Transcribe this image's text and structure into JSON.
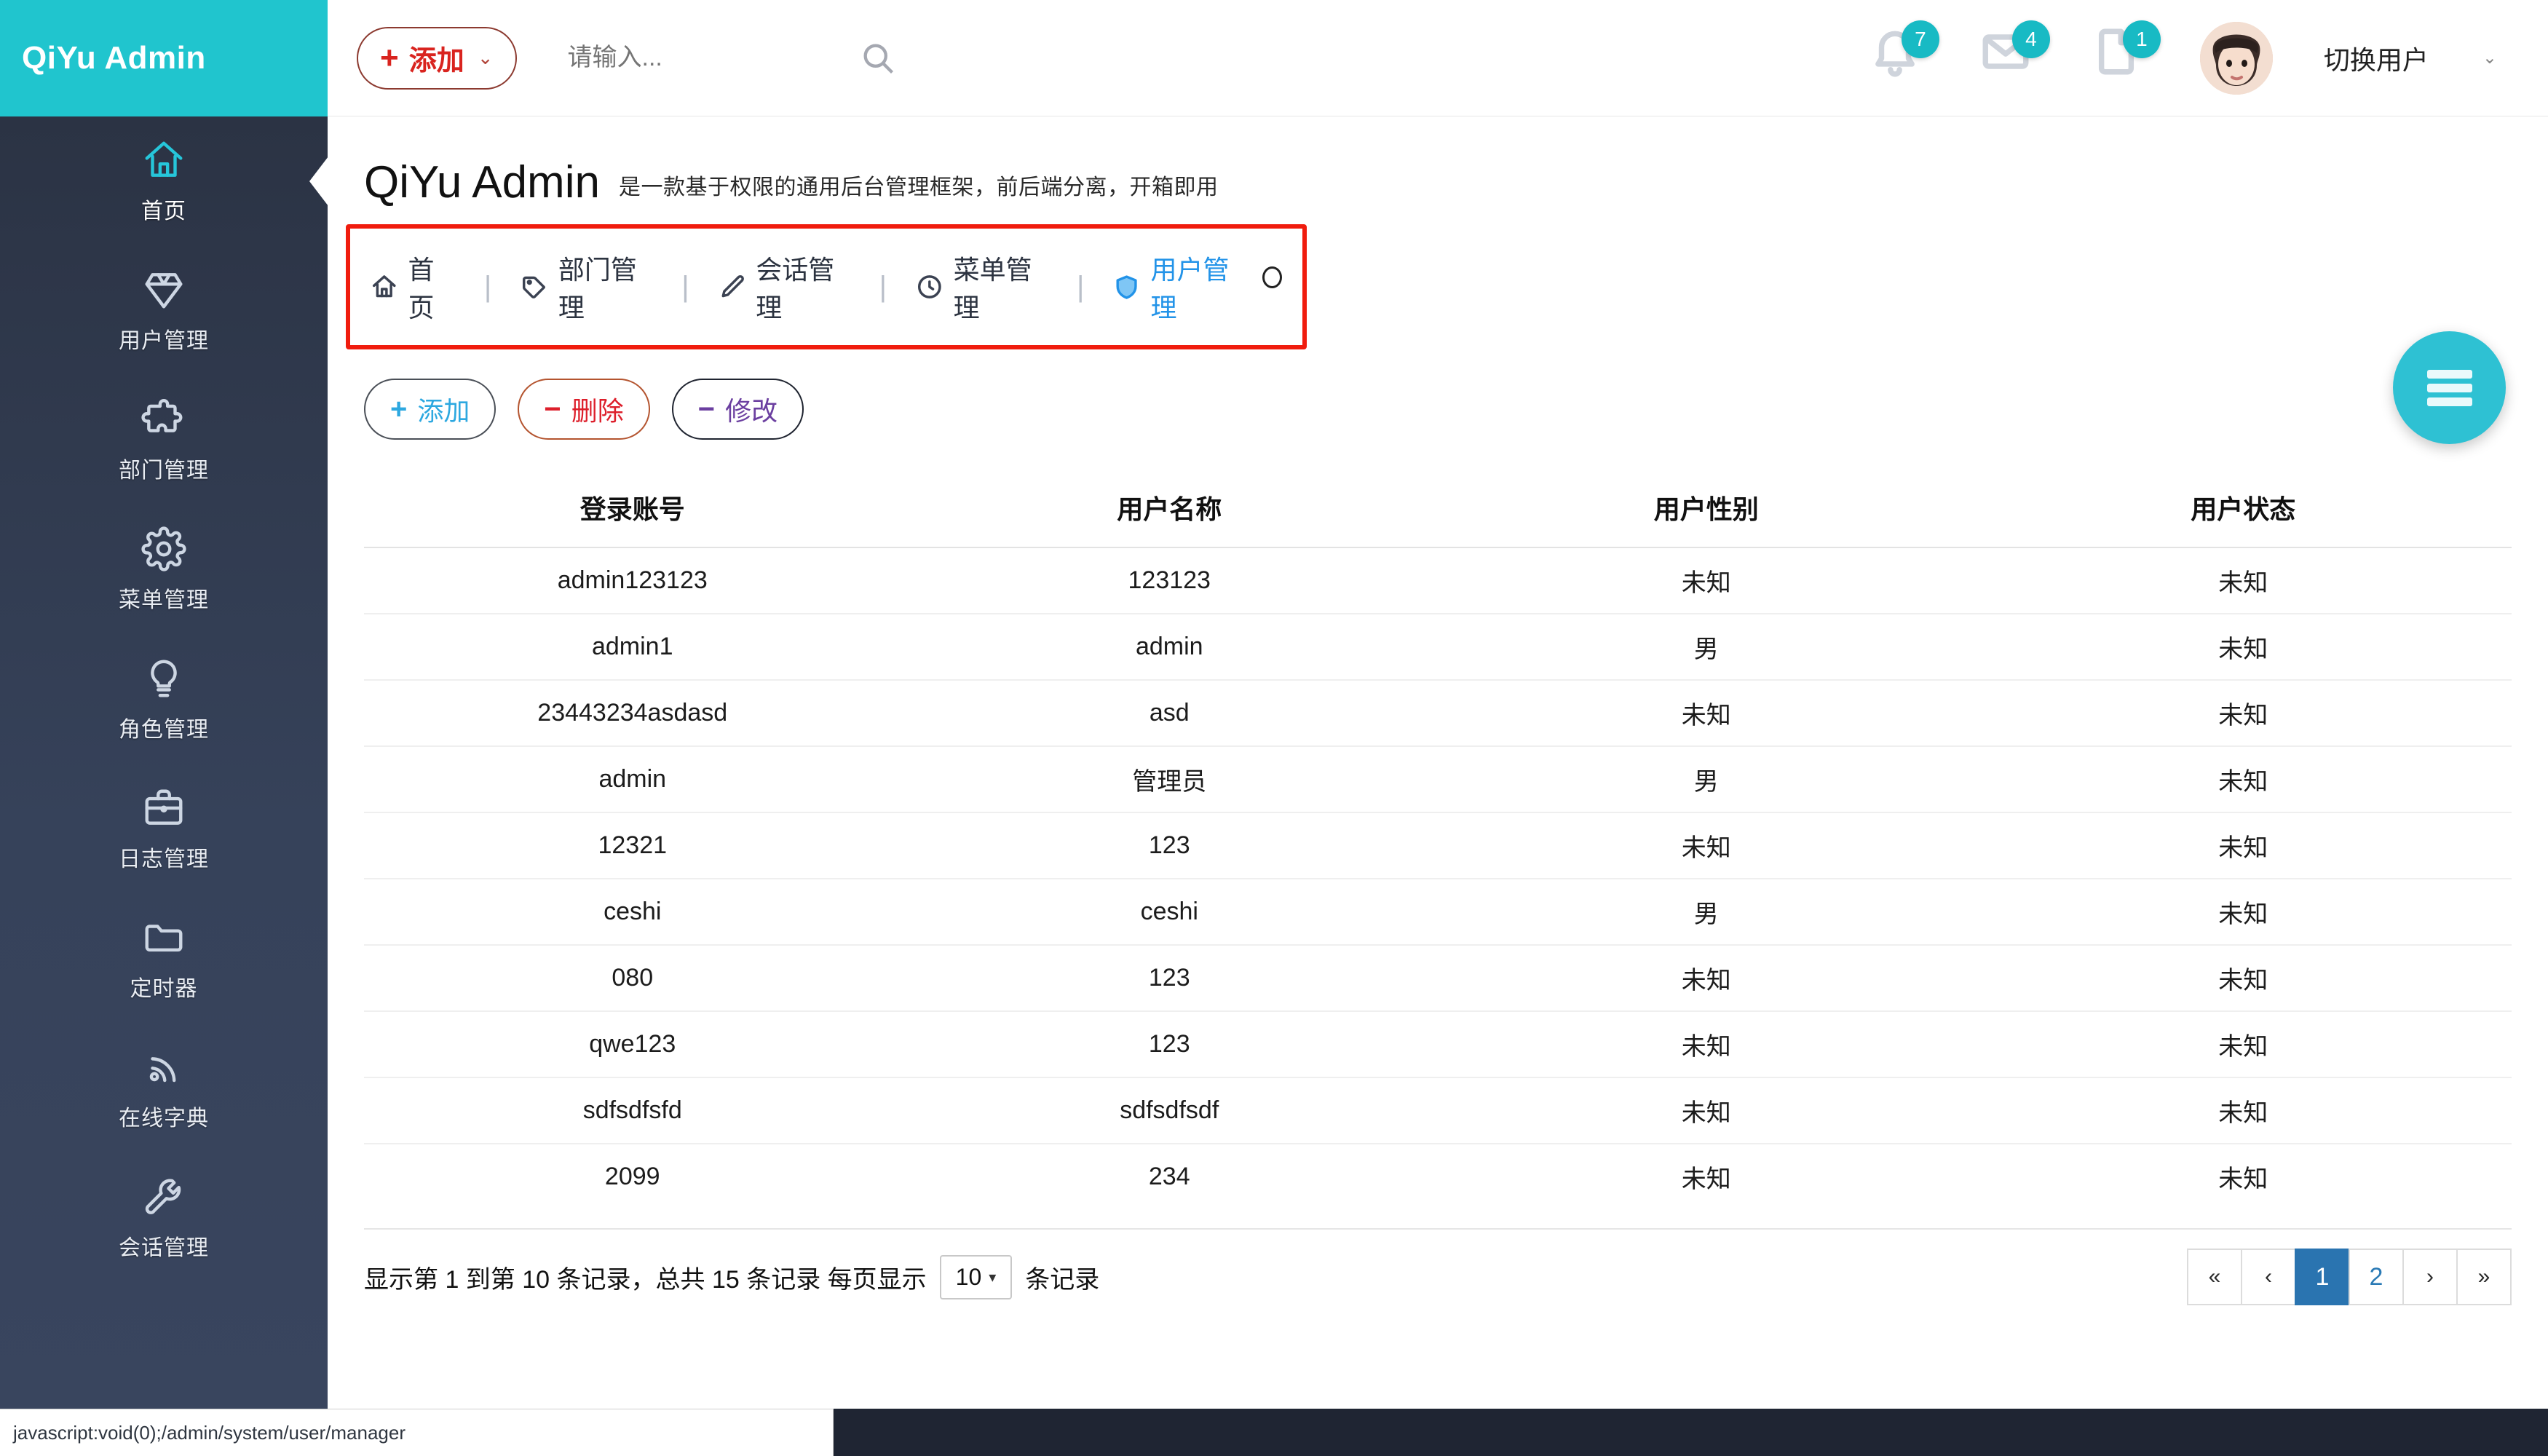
{
  "brand": {
    "name": "QiYu Admin"
  },
  "sidebar": {
    "items": [
      {
        "label": "首页",
        "icon": "home-icon",
        "active": true
      },
      {
        "label": "用户管理",
        "icon": "diamond-icon",
        "active": false
      },
      {
        "label": "部门管理",
        "icon": "puzzle-icon",
        "active": false
      },
      {
        "label": "菜单管理",
        "icon": "gear-icon",
        "active": false
      },
      {
        "label": "角色管理",
        "icon": "bulb-icon",
        "active": false
      },
      {
        "label": "日志管理",
        "icon": "briefcase-icon",
        "active": false
      },
      {
        "label": "定时器",
        "icon": "folder-icon",
        "active": false
      },
      {
        "label": "在线字典",
        "icon": "signal-icon",
        "active": false
      },
      {
        "label": "会话管理",
        "icon": "wrench-icon",
        "active": false
      }
    ]
  },
  "topbar": {
    "add_button": {
      "plus": "+",
      "label": "添加",
      "caret": "⌄"
    },
    "search": {
      "value": "",
      "placeholder": "请输入..."
    },
    "search_icon": "search-icon",
    "notifications": [
      {
        "icon": "bell-icon",
        "count": "7"
      },
      {
        "icon": "envelope-icon",
        "count": "4"
      },
      {
        "icon": "file-icon",
        "count": "1"
      }
    ],
    "user": {
      "name": "切换用户",
      "caret": "⌄",
      "avatar": "avatar"
    }
  },
  "page": {
    "title": "QiYu Admin",
    "subtitle": "是一款基于权限的通用后台管理框架，前后端分离，开箱即用"
  },
  "tabs": [
    {
      "label": "首页",
      "icon": "home-icon",
      "active": false,
      "closable": false
    },
    {
      "label": "部门管理",
      "icon": "tag-icon",
      "active": false,
      "closable": false
    },
    {
      "label": "会话管理",
      "icon": "edit-icon",
      "active": false,
      "closable": false
    },
    {
      "label": "菜单管理",
      "icon": "clock-icon",
      "active": false,
      "closable": false
    },
    {
      "label": "用户管理",
      "icon": "shield-icon",
      "active": true,
      "closable": true
    }
  ],
  "tab_separator": "|",
  "actions": [
    {
      "symbol": "+",
      "label": "添加",
      "style": "add"
    },
    {
      "symbol": "−",
      "label": "删除",
      "style": "del"
    },
    {
      "symbol": "−",
      "label": "修改",
      "style": "edit"
    }
  ],
  "table": {
    "columns": [
      "登录账号",
      "用户名称",
      "用户性别",
      "用户状态"
    ],
    "rows": [
      [
        "admin123123",
        "123123",
        "未知",
        "未知"
      ],
      [
        "admin1",
        "admin",
        "男",
        "未知"
      ],
      [
        "23443234asdasd",
        "asd",
        "未知",
        "未知"
      ],
      [
        "admin",
        "管理员",
        "男",
        "未知"
      ],
      [
        "12321",
        "123",
        "未知",
        "未知"
      ],
      [
        "ceshi",
        "ceshi",
        "男",
        "未知"
      ],
      [
        "080",
        "123",
        "未知",
        "未知"
      ],
      [
        "qwe123",
        "123",
        "未知",
        "未知"
      ],
      [
        "sdfsdfsfd",
        "sdfsdfsdf",
        "未知",
        "未知"
      ],
      [
        "2099",
        "234",
        "未知",
        "未知"
      ]
    ]
  },
  "footer": {
    "info_prefix": "显示第 1 到第 10 条记录，总共 15 条记录 每页显示",
    "page_size": "10",
    "page_size_caret": "▾",
    "info_suffix": "条记录",
    "pager": [
      {
        "label": "«",
        "type": "arrow",
        "active": false
      },
      {
        "label": "‹",
        "type": "arrow",
        "active": false
      },
      {
        "label": "1",
        "type": "number",
        "active": true
      },
      {
        "label": "2",
        "type": "number",
        "active": false
      },
      {
        "label": "›",
        "type": "arrow",
        "active": false
      },
      {
        "label": "»",
        "type": "arrow",
        "active": false
      }
    ]
  },
  "fab": {
    "icon": "hamburger-menu-icon"
  },
  "statusbar": {
    "url": "javascript:void(0);/admin/system/user/manager"
  },
  "colors": {
    "brand_teal": "#20c5ce",
    "sidebar_dark": "#2b3344",
    "highlight_red": "#f01c0e",
    "tab_active_blue": "#2293e8",
    "pager_active": "#2a74b0"
  }
}
